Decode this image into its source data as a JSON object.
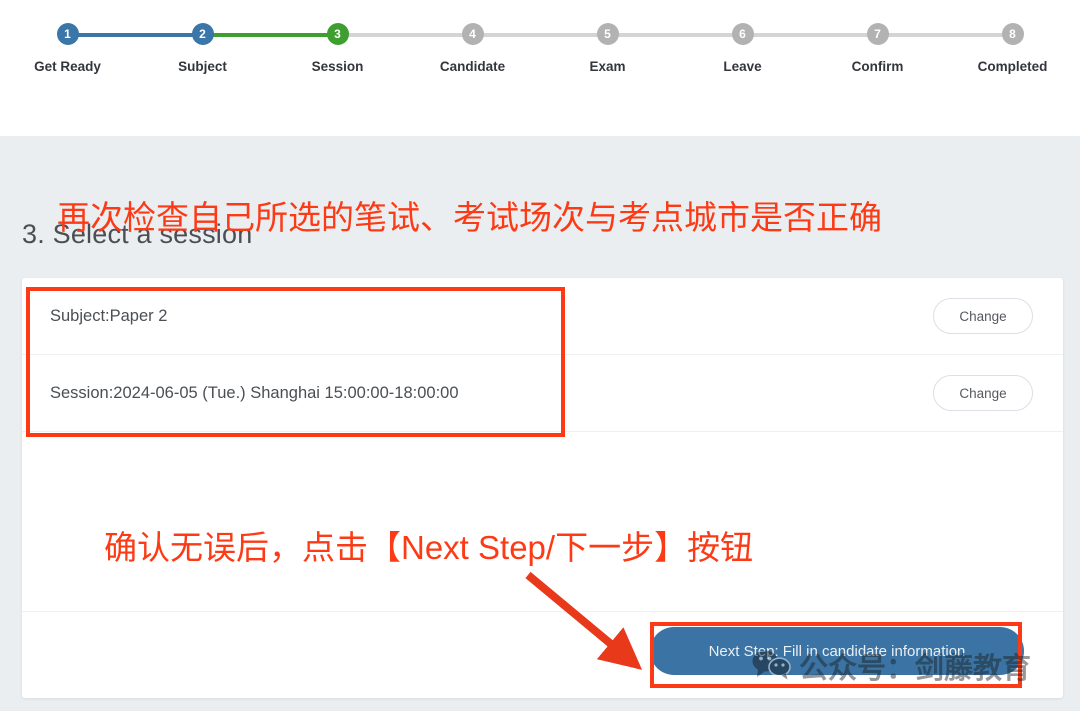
{
  "stepper": {
    "steps": [
      {
        "number": "1",
        "label": "Get Ready",
        "state": "done"
      },
      {
        "number": "2",
        "label": "Subject",
        "state": "done"
      },
      {
        "number": "3",
        "label": "Session",
        "state": "active"
      },
      {
        "number": "4",
        "label": "Candidate",
        "state": "pending"
      },
      {
        "number": "5",
        "label": "Exam",
        "state": "pending"
      },
      {
        "number": "6",
        "label": "Leave",
        "state": "pending"
      },
      {
        "number": "7",
        "label": "Confirm",
        "state": "pending"
      },
      {
        "number": "8",
        "label": "Completed",
        "state": "pending"
      }
    ],
    "colors": {
      "done": "#3a76a8",
      "active": "#3e9e2f",
      "pending": "#b2b2b2",
      "bar_pending": "#d4d4d4"
    }
  },
  "page": {
    "title": "3. Select a session",
    "background_color": "#eaeef0"
  },
  "card": {
    "rows": [
      {
        "text": "Subject:Paper 2",
        "change_label": "Change"
      },
      {
        "text": "Session:2024-06-05 (Tue.) Shanghai 15:00:00-18:00:00",
        "change_label": "Change"
      }
    ],
    "next_step_label": "Next Step: Fill in candidate information",
    "next_step_color": "#3a73a4"
  },
  "annotations": {
    "color": "#fc3b16",
    "top_note": "再次检查自己所选的笔试、考试场次与考点城市是否正确",
    "bottom_note": "确认无误后，点击【Next Step/下一步】按钮",
    "highlight_rows_box": "red-rectangle-around-subject-and-session-rows",
    "highlight_button_box": "red-rectangle-around-next-step-button",
    "arrow": "red-arrow-pointing-to-next-step-button"
  },
  "watermark": {
    "text": "公众号：剑藤教育",
    "icon": "wechat-icon"
  }
}
